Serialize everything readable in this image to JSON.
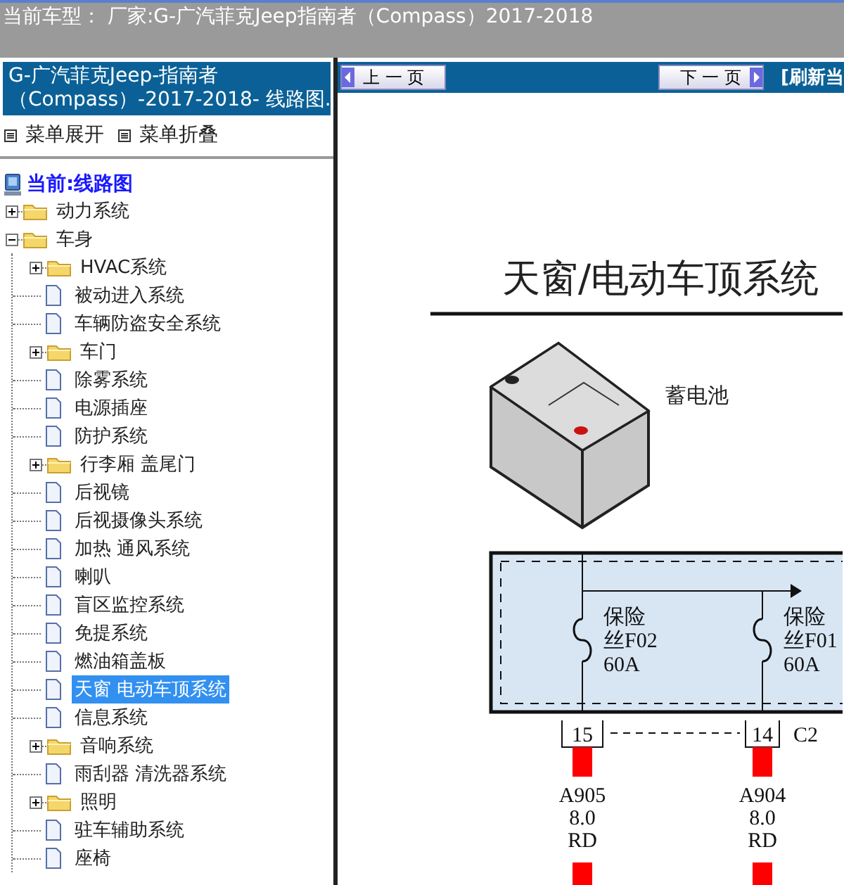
{
  "header": {
    "title": "当前车型： 厂家:G-广汽菲克Jeep指南者（Compass）2017-2018"
  },
  "sidebar": {
    "heading_lines": [
      "G-广汽菲克Jeep-指南者",
      "（Compass）-2017-2018- 线路图."
    ],
    "menu": [
      {
        "label": "菜单展开"
      },
      {
        "label": "菜单折叠"
      }
    ],
    "tree_root": "当前:线路图",
    "tree": [
      {
        "label": "动力系统",
        "kind": "folder",
        "expanded": false,
        "selected": false
      },
      {
        "label": "车身",
        "kind": "folder",
        "expanded": true,
        "selected": false,
        "children": [
          {
            "label": "HVAC系统",
            "kind": "folder",
            "expanded": false,
            "selected": false
          },
          {
            "label": "被动进入系统",
            "kind": "page",
            "selected": false
          },
          {
            "label": "车辆防盗安全系统",
            "kind": "page",
            "selected": false
          },
          {
            "label": "车门",
            "kind": "folder",
            "expanded": false,
            "selected": false
          },
          {
            "label": "除雾系统",
            "kind": "page",
            "selected": false
          },
          {
            "label": "电源插座",
            "kind": "page",
            "selected": false
          },
          {
            "label": "防护系统",
            "kind": "page",
            "selected": false
          },
          {
            "label": "行李厢 盖尾门",
            "kind": "folder",
            "expanded": false,
            "selected": false
          },
          {
            "label": "后视镜",
            "kind": "page",
            "selected": false
          },
          {
            "label": "后视摄像头系统",
            "kind": "page",
            "selected": false
          },
          {
            "label": "加热 通风系统",
            "kind": "page",
            "selected": false
          },
          {
            "label": "喇叭",
            "kind": "page",
            "selected": false
          },
          {
            "label": "盲区监控系统",
            "kind": "page",
            "selected": false
          },
          {
            "label": "免提系统",
            "kind": "page",
            "selected": false
          },
          {
            "label": "燃油箱盖板",
            "kind": "page",
            "selected": false
          },
          {
            "label": "天窗 电动车顶系统",
            "kind": "page",
            "selected": true
          },
          {
            "label": "信息系统",
            "kind": "page",
            "selected": false
          },
          {
            "label": "音响系统",
            "kind": "folder",
            "expanded": false,
            "selected": false
          },
          {
            "label": "雨刮器 清洗器系统",
            "kind": "page",
            "selected": false
          },
          {
            "label": "照明",
            "kind": "folder",
            "expanded": false,
            "selected": false
          },
          {
            "label": "驻车辅助系统",
            "kind": "page",
            "selected": false
          },
          {
            "label": "座椅",
            "kind": "page",
            "selected": false
          }
        ]
      }
    ]
  },
  "toolbar": {
    "prev": "上 一 页",
    "next": "下 一 页",
    "refresh": "[刷新当"
  },
  "diagram": {
    "title": "天窗/电动车顶系统",
    "battery_label": "蓄电池",
    "fuses": [
      {
        "lines": [
          "保险",
          "丝F02",
          "60A"
        ]
      },
      {
        "lines": [
          "保险",
          "丝F01",
          "60A"
        ]
      }
    ],
    "connector": "C2",
    "pins": [
      "15",
      "14"
    ],
    "wires": [
      {
        "circuit": "A905",
        "gauge": "8.0",
        "insulation": "RD"
      },
      {
        "circuit": "A904",
        "gauge": "8.0",
        "insulation": "RD"
      }
    ]
  }
}
